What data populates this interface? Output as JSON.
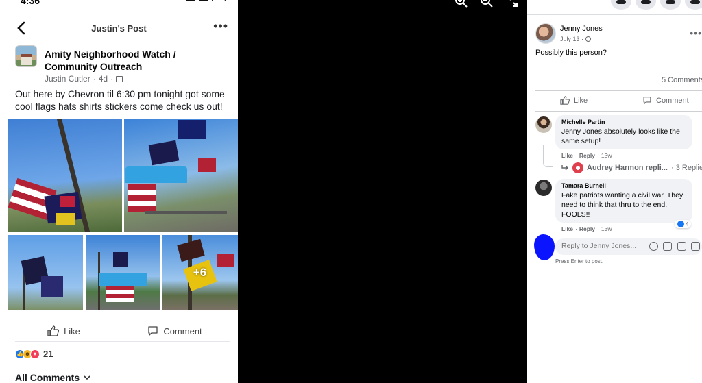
{
  "phone": {
    "status_time": "4:36",
    "nav_title": "Justin's Post",
    "more": "•••",
    "post": {
      "group_name": "Amity Neighborhood Watch / Community Outreach",
      "author": "Justin Cutler",
      "time": "4d",
      "text": "Out here by Chevron til 6:30 pm tonight got some cool flags hats shirts stickers come check us out!",
      "more_photos": "+6"
    },
    "actions": {
      "like": "Like",
      "comment": "Comment"
    },
    "reactions": {
      "count": "21"
    },
    "all_comments": "All Comments"
  },
  "panel": {
    "post_author": "Jenny Jones",
    "post_date": "July 13 ·",
    "more": "•••",
    "post_text": "Possibly this person?",
    "comment_count": "5 Comments",
    "actions": {
      "like": "Like",
      "comment": "Comment"
    },
    "comments": [
      {
        "author": "Michelle Partin",
        "mention": "Jenny Jones",
        "text": " absolutely looks like the same setup!",
        "like": "Like",
        "reply": "Reply",
        "time": "13w",
        "replies_preview": {
          "name": "Audrey Harmon repli...",
          "count": "· 3 Replies"
        }
      },
      {
        "author": "Tamara Burnell",
        "text": "Fake patriots wanting a civil war. They need to think that thru to the end. FOOLS!!",
        "like": "Like",
        "reply": "Reply",
        "time": "13w",
        "like_count": "4"
      }
    ],
    "reply_placeholder": "Reply to Jenny Jones...",
    "press_enter": "Press Enter to post."
  },
  "colors": {
    "fb_blue": "#1877f2",
    "scribble": "#0a14ff",
    "bubble": "#f0f2f5"
  }
}
